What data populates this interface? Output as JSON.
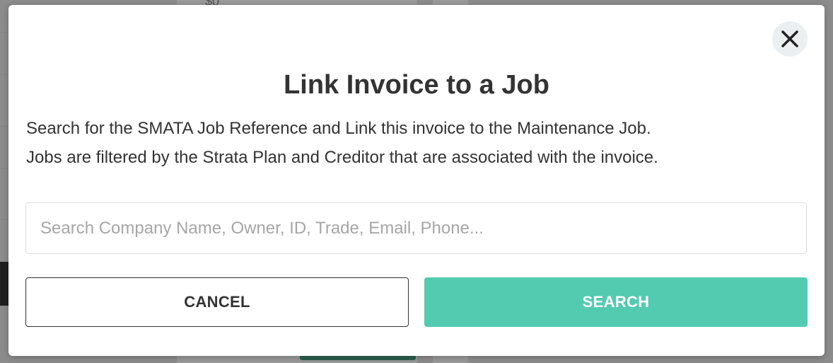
{
  "modal": {
    "title": "Link Invoice to a Job",
    "description_line_1": "Search for the SMATA Job Reference and Link this invoice to the Maintenance Job.",
    "description_line_2": "Jobs are filtered by the Strata Plan and Creditor that are associated with the invoice.",
    "close_icon": "close-icon",
    "search": {
      "placeholder": "Search Company Name, Owner, ID, Trade, Email, Phone...",
      "value": ""
    },
    "buttons": {
      "cancel_label": "CANCEL",
      "search_label": "SEARCH"
    }
  },
  "background": {
    "partial_text": "$0"
  },
  "colors": {
    "accent": "#52cbb0",
    "text": "#333333",
    "overlay": "#8c8c8c",
    "close_button_bg": "#eceff1"
  }
}
